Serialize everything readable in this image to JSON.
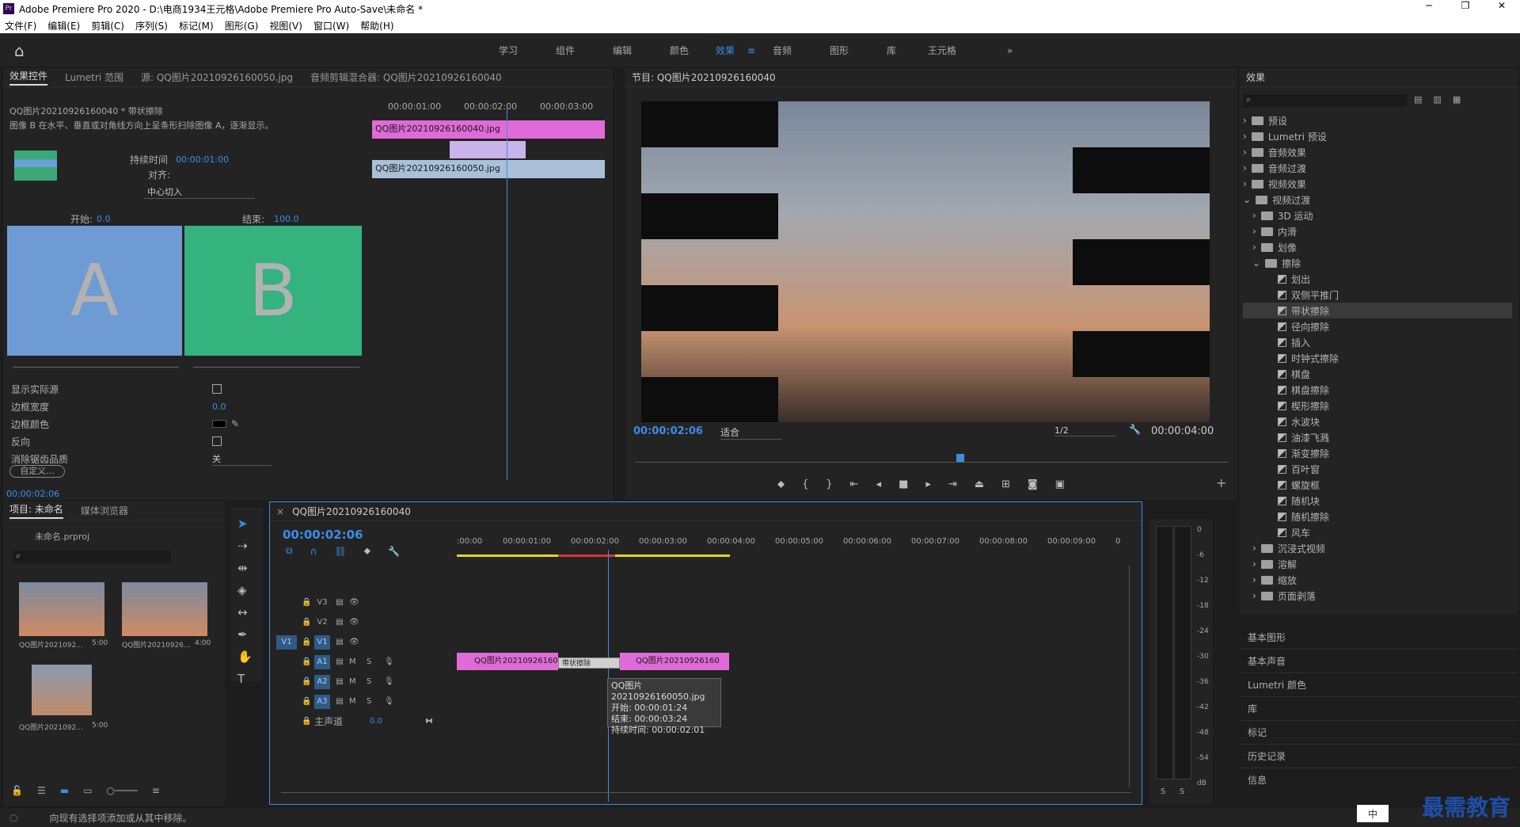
{
  "window": {
    "title": "Adobe Premiere Pro 2020 - D:\\电商1934王元格\\Adobe Premiere Pro Auto-Save\\未命名 *",
    "app_badge": "Pr"
  },
  "menu": [
    "文件(F)",
    "编辑(E)",
    "剪辑(C)",
    "序列(S)",
    "标记(M)",
    "图形(G)",
    "视图(V)",
    "窗口(W)",
    "帮助(H)"
  ],
  "workspaces": [
    "学习",
    "组件",
    "编辑",
    "颜色",
    "效果",
    "音频",
    "图形",
    "库",
    "王元格"
  ],
  "workspace_active": "效果",
  "effect_controls": {
    "tabs": [
      "效果控件",
      "Lumetri 范围",
      "源: QQ图片20210926160050.jpg",
      "音频剪辑混合器: QQ图片20210926160040"
    ],
    "clip_label": "QQ图片20210926160040 * 带状擦除",
    "description": "图像 B 在水平、垂直或对角线方向上呈条形扫除图像 A，逐渐显示。",
    "duration_label": "持续时间",
    "duration_value": "00:00:01:00",
    "align_label": "对齐:",
    "align_value": "中心切入",
    "start_label": "开始:",
    "start_value": "0.0",
    "end_label": "结束:",
    "end_value": "100.0",
    "a_label": "A",
    "b_label": "B",
    "props": [
      {
        "label": "显示实际源"
      },
      {
        "label": "边框宽度",
        "value": "0.0"
      },
      {
        "label": "边框颜色"
      },
      {
        "label": "反向"
      },
      {
        "label": "消除锯齿品质",
        "value": "关"
      }
    ],
    "custom_button": "自定义...",
    "timecode": "00:00:02:06",
    "mini_ruler": [
      "00:00:01:00",
      "00:00:02:00",
      "00:00:03:00"
    ],
    "clip_a": "QQ图片20210926160040.jpg",
    "clip_b": "QQ图片20210926160050.jpg"
  },
  "program": {
    "title": "节目: QQ图片20210926160040",
    "timecode": "00:00:02:06",
    "fit": "适合",
    "quality": "1/2",
    "duration": "00:00:04:00"
  },
  "effects_panel": {
    "title": "效果",
    "top": [
      "预设",
      "Lumetri 预设",
      "音频效果",
      "音频过渡",
      "视频效果",
      "视频过渡"
    ],
    "sub": [
      "3D 运动",
      "内滑",
      "划像",
      "擦除"
    ],
    "wipes": [
      "划出",
      "双侧平推门",
      "带状擦除",
      "径向擦除",
      "插入",
      "时钟式擦除",
      "棋盘",
      "棋盘擦除",
      "楔形擦除",
      "水波块",
      "油漆飞溅",
      "渐变擦除",
      "百叶窗",
      "螺旋框",
      "随机块",
      "随机擦除",
      "风车"
    ],
    "after": [
      "沉浸式视频",
      "溶解",
      "缩放",
      "页面剥落"
    ],
    "selected": "带状擦除",
    "panels": [
      "基本图形",
      "基本声音",
      "Lumetri 颜色",
      "库",
      "标记",
      "历史记录",
      "信息"
    ]
  },
  "project": {
    "tabs": [
      "项目: 未命名",
      "媒体浏览器"
    ],
    "file": "未命名.prproj",
    "items": [
      {
        "name": "QQ图片2021092...",
        "dur": "5:00"
      },
      {
        "name": "QQ图片20210926...",
        "dur": "4:00"
      },
      {
        "name": "QQ图片2021092...",
        "dur": "5:00"
      }
    ]
  },
  "timeline": {
    "tab": "QQ图片20210926160040",
    "timecode": "00:00:02:06",
    "ruler": [
      ":00:00",
      "00:00:01:00",
      "00:00:02:00",
      "00:00:03:00",
      "00:00:04:00",
      "00:00:05:00",
      "00:00:06:00",
      "00:00:07:00",
      "00:00:08:00",
      "00:00:09:00",
      "0"
    ],
    "video_tracks": [
      "V3",
      "V2",
      "V1"
    ],
    "audio_tracks": [
      "A1",
      "A2",
      "A3"
    ],
    "source_v": "V1",
    "master_label": "主声道",
    "master_value": "0.0",
    "clip1": "QQ图片20210926160",
    "clip2": "QQ图片20210926160",
    "transition": "带状擦除",
    "tooltip": {
      "name": "QQ图片20210926160050.jpg",
      "start": "开始: 00:00:01:24",
      "end": "结束: 00:00:03:24",
      "dur": "持续时间: 00:00:02:01"
    }
  },
  "meter": {
    "scale": [
      "0",
      "-6",
      "-12",
      "-18",
      "-24",
      "-30",
      "-36",
      "-42",
      "-48",
      "-54",
      "dB"
    ],
    "s": "S"
  },
  "status": "向现有选择项添加或从其中移除。",
  "watermark": "最需教育",
  "ime": "中"
}
